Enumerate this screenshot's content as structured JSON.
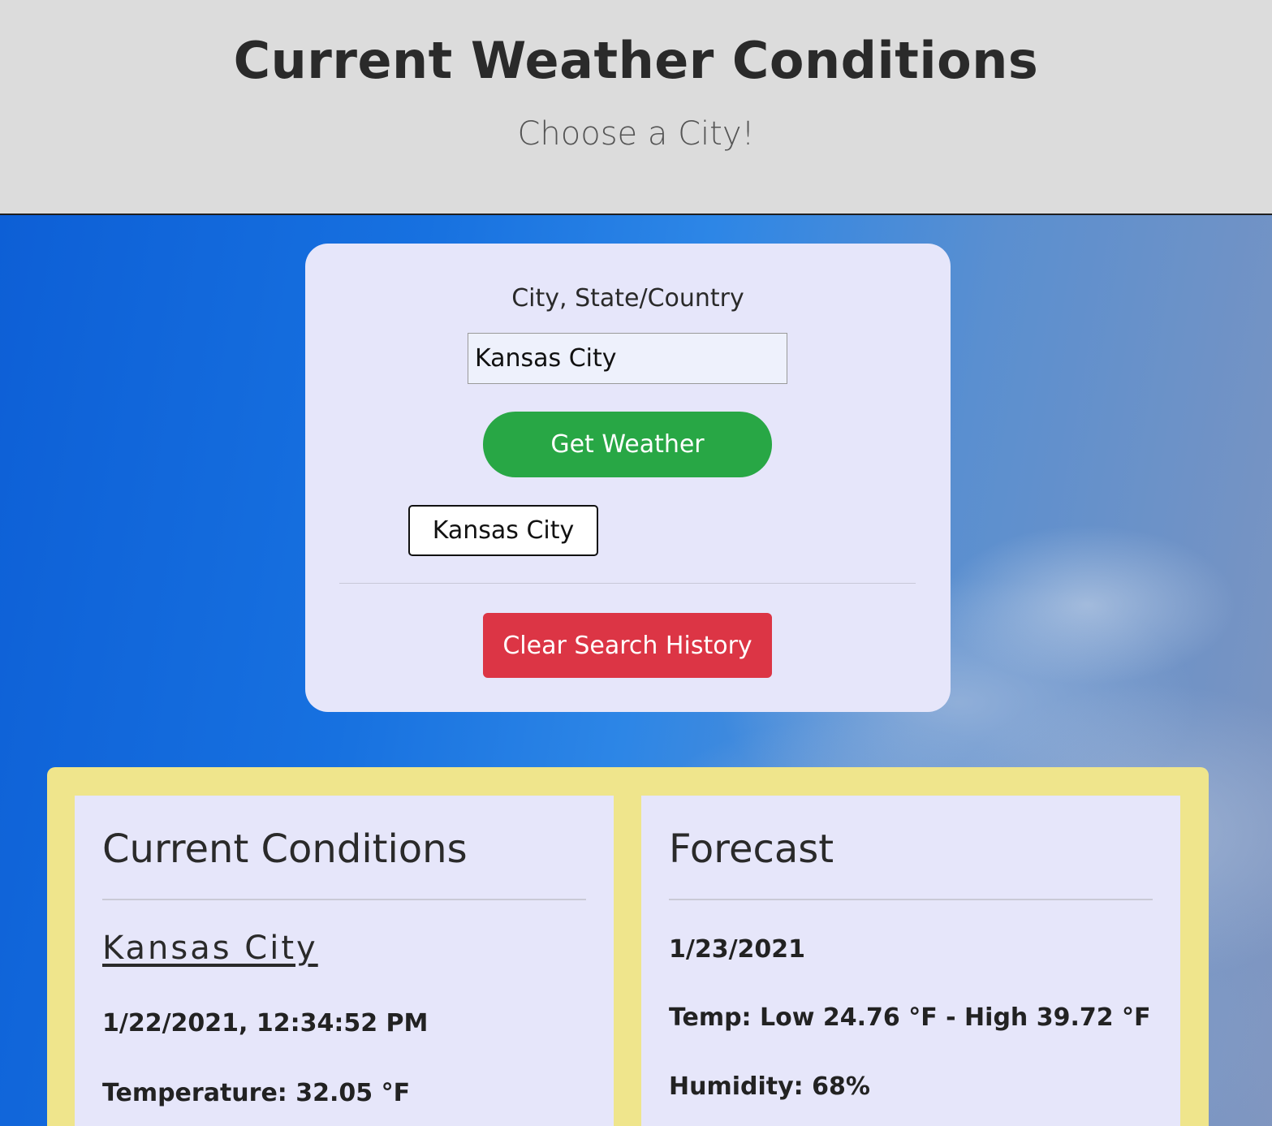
{
  "header": {
    "title": "Current Weather Conditions",
    "subtitle": "Choose a City!"
  },
  "search": {
    "label": "City, State/Country",
    "input_value": "Kansas City",
    "get_button": "Get Weather",
    "history": [
      "Kansas City"
    ],
    "clear_button": "Clear Search History"
  },
  "current": {
    "title": "Current Conditions",
    "city": "Kansas City",
    "datetime": "1/22/2021, 12:34:52 PM",
    "temperature": "Temperature: 32.05 °F"
  },
  "forecast": {
    "title": "Forecast",
    "date": "1/23/2021",
    "temp": "Temp: Low 24.76 °F - High 39.72 °F",
    "humidity": "Humidity: 68%"
  },
  "colors": {
    "header_bg": "#dcdcdc",
    "card_bg": "#e6e6fa",
    "success": "#28a745",
    "danger": "#dc3545",
    "results_border": "#efe58c"
  }
}
